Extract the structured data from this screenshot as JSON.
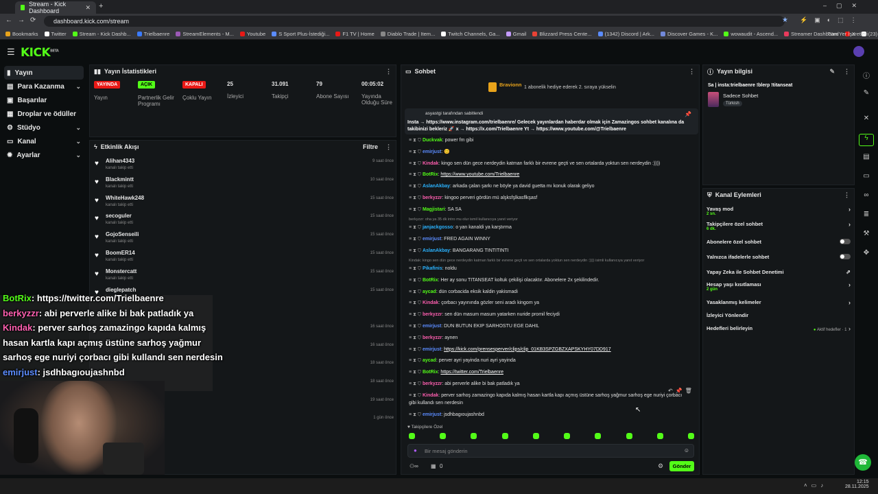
{
  "browser": {
    "active_tab": "Stream - Kick Dashboard",
    "url": "dashboard.kick.com/stream",
    "bookmarks": [
      "Bookmarks",
      "Twitter",
      "Stream - Kick Dashb...",
      "Trielbaenre",
      "StreamElements - M...",
      "Youtube",
      "S Sport Plus-İstediği...",
      "F1 TV | Home",
      "Diablo Trade | Item...",
      "Twitch Channels, Ga...",
      "Gmail",
      "Blizzard Press Cente...",
      "(1342) Discord | Ark...",
      "Discover Games - K...",
      "wowaudit - Ascend...",
      "Streamer Dashboard",
      "X",
      "(23) Trielbaenre - Yo..."
    ],
    "all_bookmarks": "Tüm Yer İşaretleri"
  },
  "kick": {
    "logo": "KICK",
    "logo_sup": "BETA"
  },
  "sidebar": {
    "items": [
      {
        "label": "Yayın"
      },
      {
        "label": "Para Kazanma"
      },
      {
        "label": "Başarılar"
      },
      {
        "label": "Droplar ve ödüller"
      },
      {
        "label": "Stüdyo"
      },
      {
        "label": "Kanal"
      },
      {
        "label": "Ayarlar"
      }
    ]
  },
  "stats": {
    "title": "Yayın İstatistikleri",
    "items": [
      {
        "badge": "YAYINDA",
        "label": "Yayın",
        "color": "#e91916"
      },
      {
        "badge": "AÇIK",
        "label": "Partnerlik Gelir Programı",
        "color": "#53fc18"
      },
      {
        "badge": "KAPALI",
        "label": "Çoklu Yayın",
        "color": "#e91916"
      },
      {
        "value": "25",
        "label": "İzleyici"
      },
      {
        "value": "31.091",
        "label": "Takipçi"
      },
      {
        "value": "79",
        "label": "Abone Sayısı"
      },
      {
        "value": "00:05:02",
        "label": "Yayında Olduğu Süre"
      }
    ]
  },
  "activity": {
    "title": "Etkinlik Akışı",
    "filter": "Filtre",
    "items": [
      {
        "name": "Alihan4343",
        "sub": "kanalı takip etti",
        "time": "9 saat önce"
      },
      {
        "name": "Blackmintt",
        "sub": "kanalı takip etti",
        "time": "10 saat önce"
      },
      {
        "name": "WhiteHawk248",
        "sub": "kanalı takip etti",
        "time": "15 saat önce"
      },
      {
        "name": "secoguler",
        "sub": "kanalı takip etti",
        "time": "15 saat önce"
      },
      {
        "name": "GojoSenseili",
        "sub": "kanalı takip etti",
        "time": "15 saat önce"
      },
      {
        "name": "BoomER14",
        "sub": "kanalı takip etti",
        "time": "15 saat önce"
      },
      {
        "name": "Monstercatt",
        "sub": "kanalı takip etti",
        "time": "15 saat önce"
      },
      {
        "name": "dieglepatch",
        "sub": "kanalı takip etti",
        "time": "15 saat önce"
      }
    ],
    "more_times": [
      "16 saat önce",
      "16 saat önce",
      "18 saat önce",
      "18 saat önce",
      "19 saat önce",
      "1 gün önce"
    ]
  },
  "chat": {
    "title": "Sohbet",
    "bravionn": "Bravionn",
    "sub_goal": "1 abonelik hediye ederek 2. sıraya yükselin",
    "pinned_by": "asyastgi tarafından sabitlendi",
    "pinned_text": "Insta → https://www.instagram.com/trielbaenre/ Gelecek yayınlardan haberdar olmak için Zamazingos sohbet kanalına da takibinizi bekleriz 🚀 x → https://x.com/Trielbaenre Yt → https://www.youtube.com/@Trielbaenre",
    "messages": [
      {
        "user": "Duckvak",
        "color": "#53fc18",
        "text": "power fm gibi"
      },
      {
        "user": "emirjust",
        "color": "#5b8cff",
        "text": "😊"
      },
      {
        "user": "Kindak",
        "color": "#ff5fb0",
        "text": "kingo sen dün gece nerdeydin katman farklı bir evrene geçti ve sen ortalarda yoktun sen nerdeydin :))))"
      },
      {
        "user": "BotRix",
        "color": "#53fc18",
        "text": "https://www.youtube.com/Trielbaenre",
        "link": true
      },
      {
        "user": "AslanAkbay",
        "color": "#2bb3ff",
        "text": "arkada çalan şarkı ne böyle ya david guetta mı konuk olarak geliyo"
      },
      {
        "user": "berkyzzr",
        "color": "#ff5fb0",
        "text": "kingoo perveri gördün mü alşksfşlkasflkşasf"
      },
      {
        "user": "Magjistari",
        "color": "#53fc18",
        "text": "SA SA"
      },
      {
        "reply": "berkyzzr: oha ya 35 dk intro mu olur ismil kullanıcıya yanıt veriyor"
      },
      {
        "user": "janjackgosso",
        "color": "#2bb3ff",
        "text": "o yan kanaldi ya karştırma"
      },
      {
        "user": "emirjust",
        "color": "#5b8cff",
        "text": "FRED AGAIN WINNY"
      },
      {
        "user": "AslanAkbay",
        "color": "#2bb3ff",
        "text": "BANGARANG TINTITINTI"
      },
      {
        "reply": "Kindak: kingo sen dün gece nerdeydin katman farklı bir evrene geçti ve sen ortalarda yoktun sen nerdeydin :)))) isimli kullanıcıya yanıt veriyor"
      },
      {
        "user": "Pikafinis",
        "color": "#2bb3ff",
        "text": "noldu"
      },
      {
        "user": "BotRix",
        "color": "#53fc18",
        "text": "Her ay sonu TITANSEAT koltuk çekilişi olacaktır. Abonelere 2x şekilindedir."
      },
      {
        "user": "aycad",
        "color": "#53fc18",
        "text": "dün corbacida eksik kaldin yakismadi"
      },
      {
        "user": "Kindak",
        "color": "#ff5fb0",
        "text": "çorbacı yayınında gözler seni aradı kingom ya"
      },
      {
        "user": "berkyzzr",
        "color": "#ff5fb0",
        "text": "sen dün masum masum yatarken nuride promil feciydi"
      },
      {
        "user": "emirjust",
        "color": "#5b8cff",
        "text": "DUN BUTUN EKIP SARHOSTU EGE DAHIL"
      },
      {
        "user": "berkyzzr",
        "color": "#ff5fb0",
        "text": "aynen"
      },
      {
        "user": "emirjust",
        "color": "#5b8cff",
        "text": "https://kick.com/prensesperver/clips/clip_01KB3SPZGBZXAPSKYHY07DD917",
        "link": true
      },
      {
        "user": "aycad",
        "color": "#53fc18",
        "text": "perver ayri yayinda nuri ayri yayinda"
      },
      {
        "user": "BotRix",
        "color": "#53fc18",
        "text": "https://twitter.com/Trielbaenre",
        "link": true
      },
      {
        "user": "berkyzzr",
        "color": "#ff5fb0",
        "text": "abi perverle alike bi bak patladık ya"
      },
      {
        "user": "Kindak",
        "color": "#ff5fb0",
        "text": "perver sarhoş zamazingo kapıda kalmış hasan kartla kapı açmış üstüne sarhoş yağmur sarhoş ege nuriyi çorbacı"
      },
      {
        "cont": "gibi kullandı sen nerdesin"
      },
      {
        "user": "emirjust",
        "color": "#5b8cff",
        "text": "jsdhbagıoujashnbd"
      }
    ],
    "followers_only": "Takipçilere Özel",
    "input_placeholder": "Bir mesaj gönderin",
    "count": "0",
    "send": "Gönder"
  },
  "stream_info": {
    "title": "Yayın bilgisi",
    "stream_title": "Sa | insta:trielbaenre !blerp !titanseat",
    "category": "Sadece Sohbet",
    "language": "Türkish"
  },
  "channel_actions": {
    "title": "Kanal Eylemleri",
    "items": [
      {
        "label": "Yavaş mod",
        "sub": "2 sn.",
        "type": "arrow"
      },
      {
        "label": "Takipçilere özel sohbet",
        "sub": "6 dk.",
        "type": "arrow"
      },
      {
        "label": "Abonelere özel sohbet",
        "sub": "",
        "type": "toggle"
      },
      {
        "label": "Yalnızca ifadelerle sohbet",
        "sub": "",
        "type": "toggle"
      },
      {
        "label": "Yapay Zeka ile Sohbet Denetimi",
        "sub": "",
        "type": "ext"
      },
      {
        "label": "Hesap yaşı kısıtlaması",
        "sub": "2 gün",
        "type": "arrow"
      },
      {
        "label": "Yasaklanmış kelimeler",
        "sub": "",
        "type": "arrow"
      },
      {
        "label": "İzleyici Yönlendir",
        "sub": "",
        "type": "none"
      },
      {
        "label": "Hedefleri belirleyin",
        "sub": "",
        "type": "goal",
        "extra": "Aktif hedefler · 1"
      }
    ]
  },
  "overlay": {
    "lines": [
      {
        "user": "BotRix",
        "text": ": https://twitter.com/Trielbaenre",
        "color": "#53fc18"
      },
      {
        "user": "berkyzzr",
        "text": ": abi perverle alike bi bak patladık ya",
        "color": "#ff5fb0"
      },
      {
        "user": "Kindak",
        "text": ": perver sarhoş zamazingo kapıda kalmış",
        "color": "#ff5fb0"
      },
      {
        "user": "",
        "text": "hasan kartla kapı açmış üstüne sarhoş yağmur",
        "color": "#fff"
      },
      {
        "user": "",
        "text": "sarhoş ege nuriyi çorbacı gibi kullandı sen nerdesin",
        "color": "#fff"
      },
      {
        "user": "emirjust",
        "text": ": jsdhbagıoujashnbd",
        "color": "#5b8cff"
      }
    ]
  },
  "taskbar": {
    "time": "12:15",
    "date": "28.11.2025"
  },
  "colors": {
    "accent": "#53fc18",
    "bg": "#0b0e0f",
    "panel": "#141719",
    "live": "#e91916"
  }
}
